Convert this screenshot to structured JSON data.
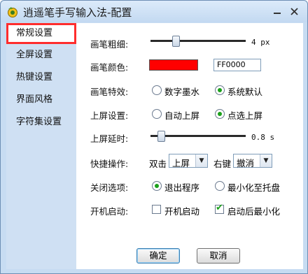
{
  "window": {
    "title": "逍遥笔手写输入法-配置",
    "minimize_glyph": "－",
    "close_glyph": "✕",
    "accent_highlight": "#ff2d2d"
  },
  "sidebar": {
    "items": [
      {
        "label": "常规设置",
        "active": true
      },
      {
        "label": "全屏设置"
      },
      {
        "label": "热键设置"
      },
      {
        "label": "界面风格"
      },
      {
        "label": "字符集设置"
      }
    ]
  },
  "settings": {
    "pen_width": {
      "label": "画笔粗细:",
      "value_text": "4 px",
      "level": 0.25
    },
    "pen_color": {
      "label": "画笔颜色:",
      "color": "#ff0000",
      "hex_text": "FF0000"
    },
    "pen_effect": {
      "label": "画笔特效:",
      "options": [
        "数字墨水",
        "系统默认"
      ],
      "selected": 1
    },
    "commit_mode": {
      "label": "上屏设置:",
      "options": [
        "自动上屏",
        "点选上屏"
      ],
      "selected": 1
    },
    "commit_delay": {
      "label": "上屏延时:",
      "value_text": "0.8 s",
      "level": 0.08
    },
    "shortcut": {
      "label": "快捷操作:",
      "double_click_label": "双击",
      "double_click_value": "上屏",
      "right_click_label": "右键",
      "right_click_value": "撤消"
    },
    "close_option": {
      "label": "关闭选项:",
      "options": [
        "退出程序",
        "最小化至托盘"
      ],
      "selected": 0
    },
    "startup": {
      "label": "开机启动:",
      "options": [
        "开机启动",
        "启动后最小化"
      ],
      "checked": [
        false,
        true
      ]
    }
  },
  "buttons": {
    "ok": "确定",
    "cancel": "取消"
  }
}
